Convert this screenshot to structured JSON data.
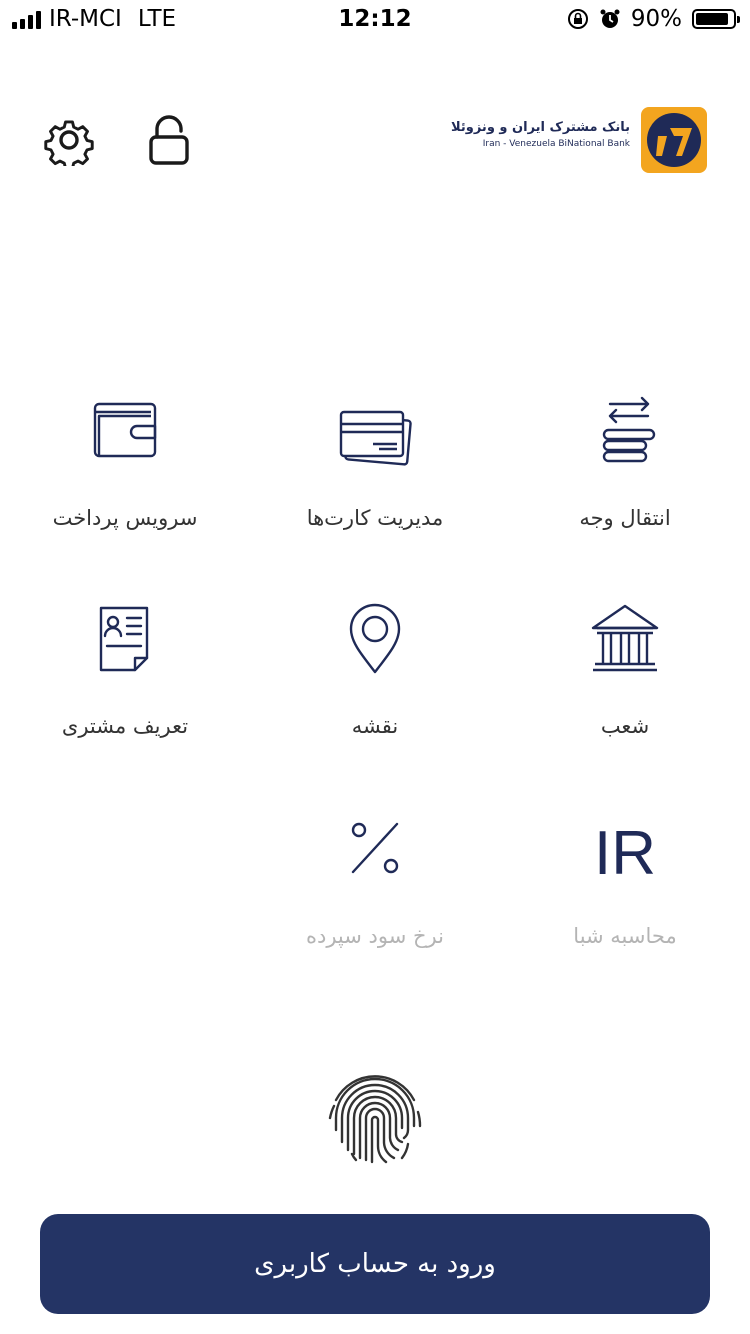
{
  "status_bar": {
    "carrier": "IR-MCI",
    "network": "LTE",
    "time": "12:12",
    "battery_percent": "90%",
    "battery_level": 0.9
  },
  "header": {
    "bank_name_fa": "بانک مشترک ایران و ونزوئلا",
    "bank_name_en": "Iran - Venezuela BiNational Bank",
    "logo_colors": {
      "orange": "#f3a51f",
      "navy": "#1f2a57"
    }
  },
  "services": [
    {
      "label": "انتقال وجه",
      "icon": "coins-transfer-icon"
    },
    {
      "label": "مدیریت کارت‌ها",
      "icon": "cards-icon"
    },
    {
      "label": "سرویس پرداخت",
      "icon": "wallet-icon"
    },
    {
      "label": "شعب",
      "icon": "bank-building-icon"
    },
    {
      "label": "نقشه",
      "icon": "map-pin-icon"
    },
    {
      "label": "تعریف مشتری",
      "icon": "customer-document-icon"
    },
    {
      "label": "محاسبه شبا",
      "icon": "iban-icon",
      "iban_text": "IR"
    },
    {
      "label": "نرخ سود سپرده",
      "icon": "percent-icon"
    }
  ],
  "login": {
    "label": "ورود به حساب کاربری"
  },
  "colors": {
    "primary": "#243465",
    "icon": "#1f2a57",
    "disabled": "#b4b4b4"
  }
}
